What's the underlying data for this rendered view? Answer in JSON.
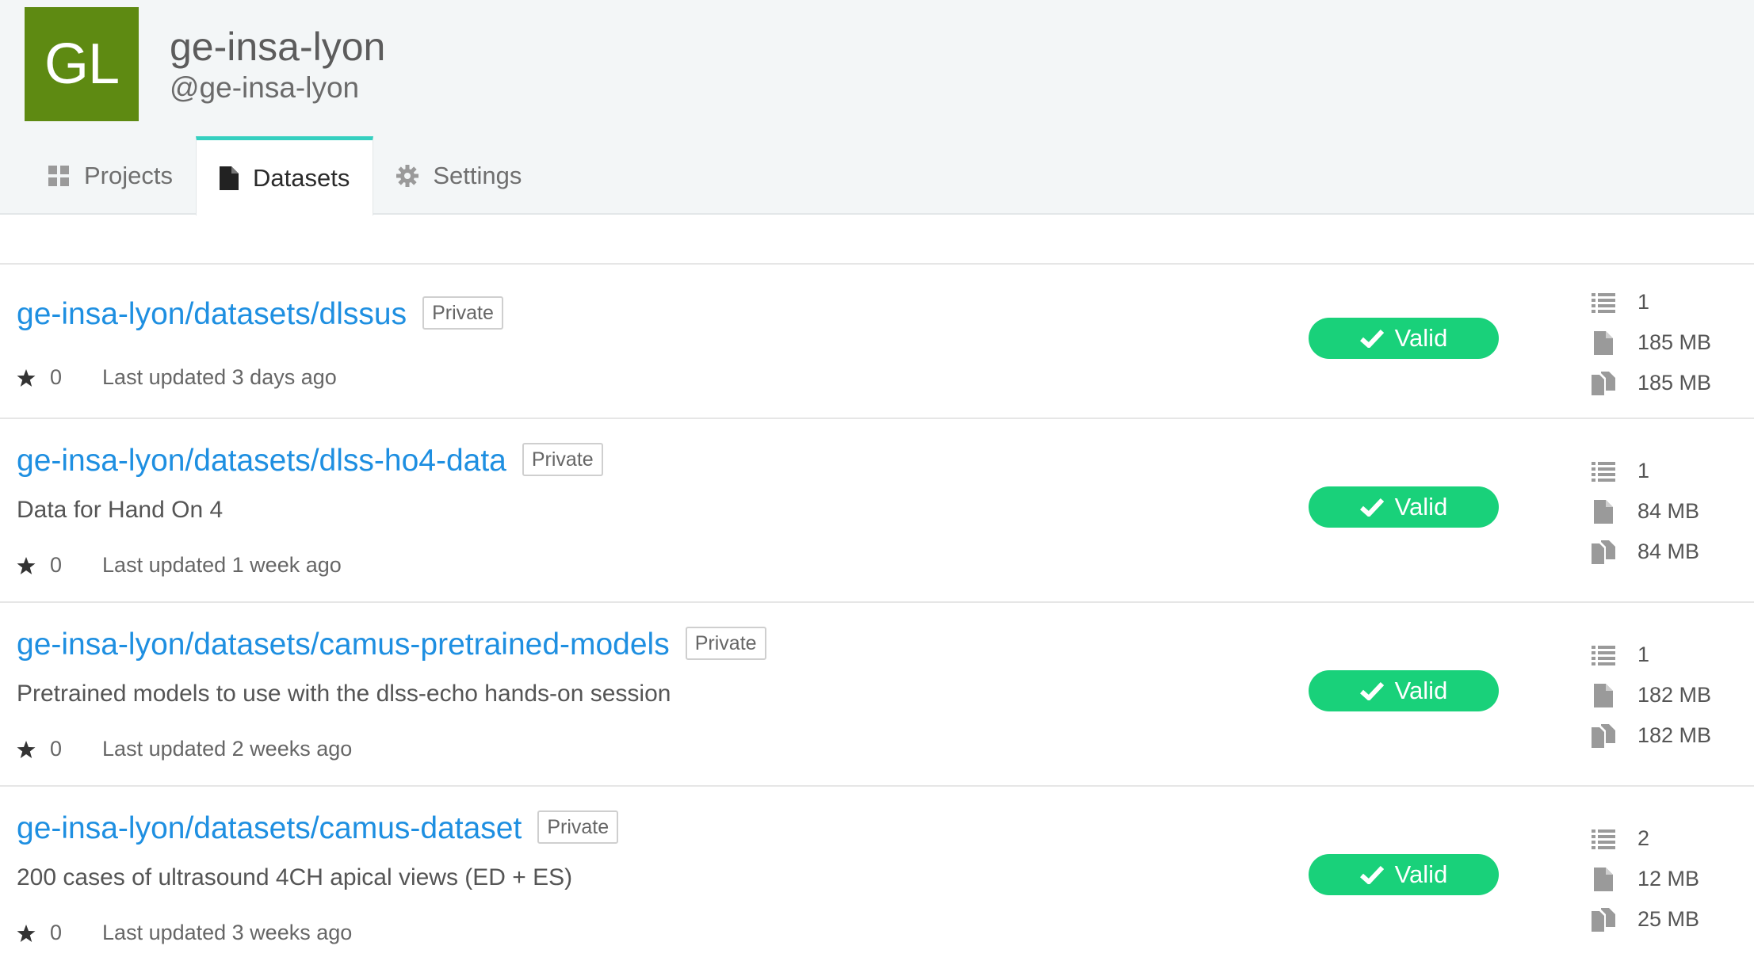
{
  "org": {
    "initials": "GL",
    "avatar_color": "#5e8a12",
    "name": "ge-insa-lyon",
    "handle": "@ge-insa-lyon"
  },
  "tabs": [
    {
      "label": "Projects",
      "icon": "grid-icon",
      "active": false
    },
    {
      "label": "Datasets",
      "icon": "file-icon",
      "active": true
    },
    {
      "label": "Settings",
      "icon": "gear-icon",
      "active": false
    }
  ],
  "colors": {
    "link": "#1e8fe1",
    "valid": "#19d17a",
    "active_tab_accent": "#35d0c0"
  },
  "datasets": [
    {
      "title": "ge-insa-lyon/datasets/dlssus",
      "badge": "Private",
      "description": "",
      "stars": "0",
      "updated": "Last updated 3 days ago",
      "status": "Valid",
      "versions": "1",
      "size": "185 MB",
      "total_size": "185 MB"
    },
    {
      "title": "ge-insa-lyon/datasets/dlss-ho4-data",
      "badge": "Private",
      "description": "Data for Hand On 4",
      "stars": "0",
      "updated": "Last updated 1 week ago",
      "status": "Valid",
      "versions": "1",
      "size": "84 MB",
      "total_size": "84 MB"
    },
    {
      "title": "ge-insa-lyon/datasets/camus-pretrained-models",
      "badge": "Private",
      "description": "Pretrained models to use with the dlss-echo hands-on session",
      "stars": "0",
      "updated": "Last updated 2 weeks ago",
      "status": "Valid",
      "versions": "1",
      "size": "182 MB",
      "total_size": "182 MB"
    },
    {
      "title": "ge-insa-lyon/datasets/camus-dataset",
      "badge": "Private",
      "description": "200 cases of ultrasound 4CH apical views (ED + ES)",
      "stars": "0",
      "updated": "Last updated 3 weeks ago",
      "status": "Valid",
      "versions": "2",
      "size": "12 MB",
      "total_size": "25 MB"
    }
  ]
}
